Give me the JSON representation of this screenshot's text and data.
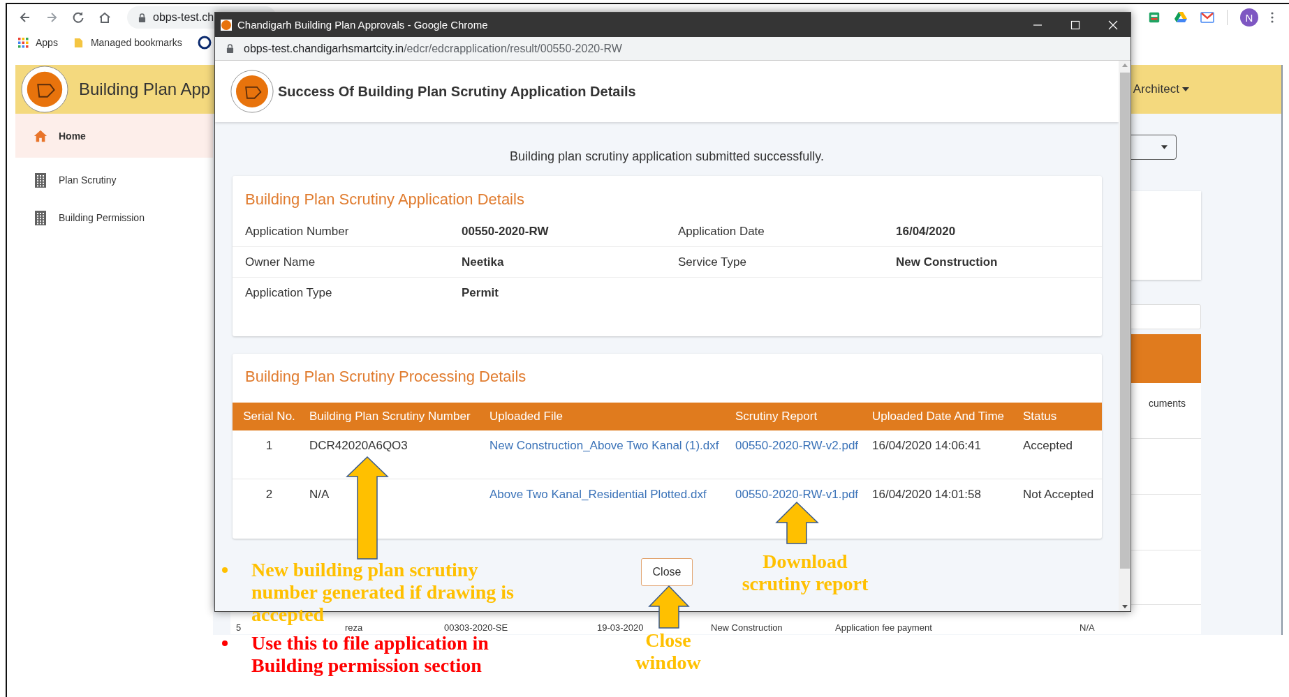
{
  "browser": {
    "omnibox": "obps-test.ch",
    "bookmarks": [
      {
        "label": "Apps"
      },
      {
        "label": "Managed bookmarks"
      }
    ],
    "profile_initial": "N"
  },
  "app": {
    "title": "Building Plan App",
    "user_menu": "Architect",
    "sidebar": [
      {
        "label": "Home",
        "selected": true
      },
      {
        "label": "Plan Scrutiny",
        "selected": false
      },
      {
        "label": "Building Permission",
        "selected": false
      }
    ],
    "table_fragment": "cuments",
    "background_row": [
      "5",
      "reza",
      "00303-2020-SE",
      "19-03-2020",
      "New Construction",
      "Application fee payment",
      "N/A"
    ]
  },
  "popup": {
    "window_title": "Chandigarh Building Plan Approvals - Google Chrome",
    "url_host": "obps-test.chandigarhsmartcity.in",
    "url_path": "/edcr/edcrapplication/result/00550-2020-RW",
    "page_title": "Success Of Building Plan Scrutiny Application Details",
    "message": "Building plan scrutiny application submitted successfully.",
    "details": {
      "title": "Building Plan Scrutiny Application Details",
      "rows": [
        [
          {
            "label": "Application Number",
            "value": "00550-2020-RW"
          },
          {
            "label": "Application Date",
            "value": "16/04/2020"
          }
        ],
        [
          {
            "label": "Owner Name",
            "value": "Neetika"
          },
          {
            "label": "Service Type",
            "value": "New Construction"
          }
        ],
        [
          {
            "label": "Application Type",
            "value": "Permit"
          }
        ]
      ]
    },
    "processing": {
      "title": "Building Plan Scrutiny Processing Details",
      "columns": [
        "Serial No.",
        "Building Plan Scrutiny Number",
        "Uploaded File",
        "Scrutiny Report",
        "Uploaded Date And Time",
        "Status"
      ],
      "rows": [
        {
          "serial": "1",
          "number": "DCR42020A6QO3",
          "file": "New Construction_Above Two Kanal (1).dxf",
          "report": "00550-2020-RW-v2.pdf",
          "uploaded": "16/04/2020 14:06:41",
          "status": "Accepted"
        },
        {
          "serial": "2",
          "number": "N/A",
          "file": "Above Two Kanal_Residential Plotted.dxf",
          "report": "00550-2020-RW-v1.pdf",
          "uploaded": "16/04/2020 14:01:58",
          "status": "Not Accepted"
        }
      ]
    },
    "close_button": "Close"
  },
  "annotations": [
    {
      "kind": "note",
      "color": "#ffc000",
      "lines": [
        "New building plan scrutiny",
        "number generated if drawing is",
        "accepted"
      ]
    },
    {
      "kind": "label",
      "color": "#ffc000",
      "lines": [
        "Download",
        "scrutiny report"
      ]
    },
    {
      "kind": "note",
      "color": "#ff0000",
      "lines": [
        "Use this to file application in",
        "Building permission section"
      ]
    },
    {
      "kind": "label",
      "color": "#ffc000",
      "lines": [
        "Close",
        "window"
      ]
    }
  ]
}
